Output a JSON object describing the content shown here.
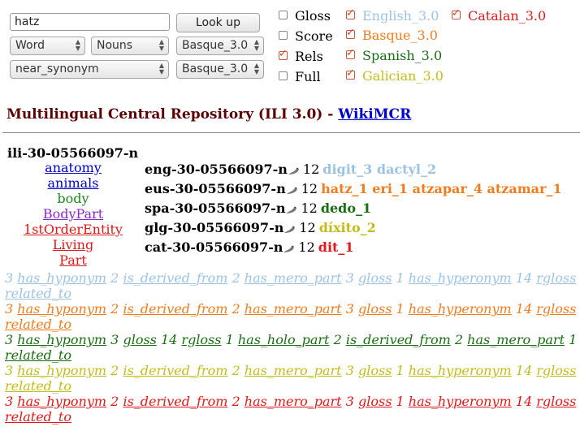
{
  "search": {
    "value": "hatz",
    "button": "Look up"
  },
  "selects": {
    "type": "Word",
    "pos": "Nouns",
    "lang1": "Basque_3.0",
    "relation": "near_synonym",
    "lang2": "Basque_3.0"
  },
  "options": [
    {
      "label": "Gloss",
      "checked": false
    },
    {
      "label": "Score",
      "checked": false
    },
    {
      "label": "Rels",
      "checked": true
    },
    {
      "label": "Full",
      "checked": false
    }
  ],
  "languages": [
    {
      "label": "English_3.0",
      "checked": true,
      "color": "#9dc3e0"
    },
    {
      "label": "Basque_3.0",
      "checked": true,
      "color": "#f07c1e"
    },
    {
      "label": "Spanish_3.0",
      "checked": true,
      "color": "#1a6e12"
    },
    {
      "label": "Galician_3.0",
      "checked": true,
      "color": "#c2bc1a"
    },
    {
      "label": "Catalan_3.0",
      "checked": true,
      "color": "#e01a1a"
    }
  ],
  "header": {
    "title": "Multilingual Central Repository (ILI 3.0) - ",
    "link": "WikiMCR"
  },
  "ili": "ili-30-05566097-n",
  "domains": [
    {
      "text": "anatomy",
      "color": "#0000cc"
    },
    {
      "text": "animals",
      "color": "#0000cc"
    },
    {
      "text": "body",
      "color": "#1a8a1a"
    },
    {
      "text": "BodyPart",
      "color": "#8a2ac8"
    },
    {
      "text": "1stOrderEntity",
      "color": "#dd1a1a"
    },
    {
      "text": "Living",
      "color": "#dd1a1a"
    },
    {
      "text": "Part",
      "color": "#dd1a1a"
    }
  ],
  "synsets": [
    {
      "code": "eng-30-05566097-n",
      "count": "12",
      "words": "digit_3 dactyl_2",
      "color": "#9dc3e0"
    },
    {
      "code": "eus-30-05566097-n",
      "count": "12",
      "words": "hatz_1 eri_1 atzapar_4 atzamar_1",
      "color": "#f07c1e"
    },
    {
      "code": "spa-30-05566097-n",
      "count": "12",
      "words": "dedo_1",
      "color": "#1a6e12"
    },
    {
      "code": "glg-30-05566097-n",
      "count": "12",
      "words": "díxito_2",
      "color": "#c2bc1a"
    },
    {
      "code": "cat-30-05566097-n",
      "count": "12",
      "words": "dit_1",
      "color": "#e01a1a"
    }
  ],
  "relations": [
    {
      "color": "#9dc3e0",
      "text": "3 has_hyponym 2 is_derived_from 2 has_mero_part 3 gloss 1 has_hyperonym 14 rgloss 1",
      "tail": "related_to"
    },
    {
      "color": "#f07c1e",
      "text": "3 has_hyponym 2 is_derived_from 2 has_mero_part 3 gloss 1 has_hyperonym 14 rgloss 1",
      "tail": "related_to"
    },
    {
      "color": "#1a6e12",
      "text": "3 has_hyponym 3 gloss 14 rgloss 1 has_holo_part 2 is_derived_from 2 has_mero_part 1",
      "tail": "related_to"
    },
    {
      "color": "#c2bc1a",
      "text": "3 has_hyponym 2 is_derived_from 2 has_mero_part 3 gloss 1 has_hyperonym 14 rgloss 1",
      "tail": "related_to"
    },
    {
      "color": "#e01a1a",
      "text": "3 has_hyponym 2 is_derived_from 2 has_mero_part 3 gloss 1 has_hyperonym 14 rgloss 1",
      "tail": "related_to"
    }
  ]
}
